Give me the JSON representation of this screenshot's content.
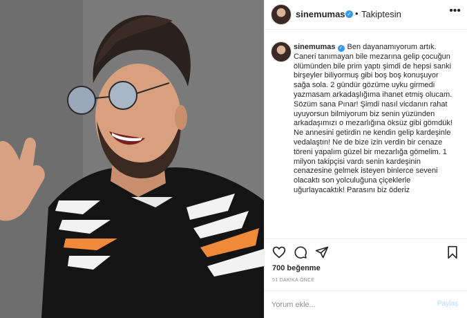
{
  "post": {
    "username": "sinemumas",
    "follow_status": "Takiptesin",
    "dot_separator": "•",
    "more_icon": "ellipsis-icon"
  },
  "caption": {
    "username": "sinemumas",
    "text": "Ben dayanamıyorum artık. Caneri tanımayan bile mezarına gelip çocuğun ölümünden bile prim yaptı şimdi de hepsi sanki birşeyler biliyormuş gibi boş boş konuşuyor sağa sola. 2 gündür gözüme uyku girmedi yazmasam arkadaşlığıma ihanet etmiş olucam.\nSözüm sana Pınar! Şimdi nasıl vicdanın rahat uyuyorsun bilmiyorum biz senin yüzünden arkadaşımızı o mezarlığına öksüz gibi gömdük! Ne annesini getirdin ne kendin gelip kardeşinle vedalaştın! Ne de bize izin verdin bir cenaze töreni yapalım güzel bir mezarlığa gömelim. 1 milyon takipçisi vardı senin kardeşinin cenazesine gelmek isteyen binlerce seveni olacaktı son yolculuğuna çiçeklerle uğurlayacaktık! Parasını biz öderiz"
  },
  "actions": {
    "like_icon": "heart-icon",
    "comment_icon": "comment-bubble-icon",
    "share_icon": "paper-plane-icon",
    "save_icon": "bookmark-icon"
  },
  "likes": "700 beğenme",
  "timestamp": "51 DAKİKA ÖNCE",
  "comment": {
    "placeholder": "Yorum ekle...",
    "post_label": "Paylaş"
  },
  "colors": {
    "accent_blue": "#3897f0",
    "post_button_disabled": "#b3dbff",
    "border": "#efefef"
  }
}
